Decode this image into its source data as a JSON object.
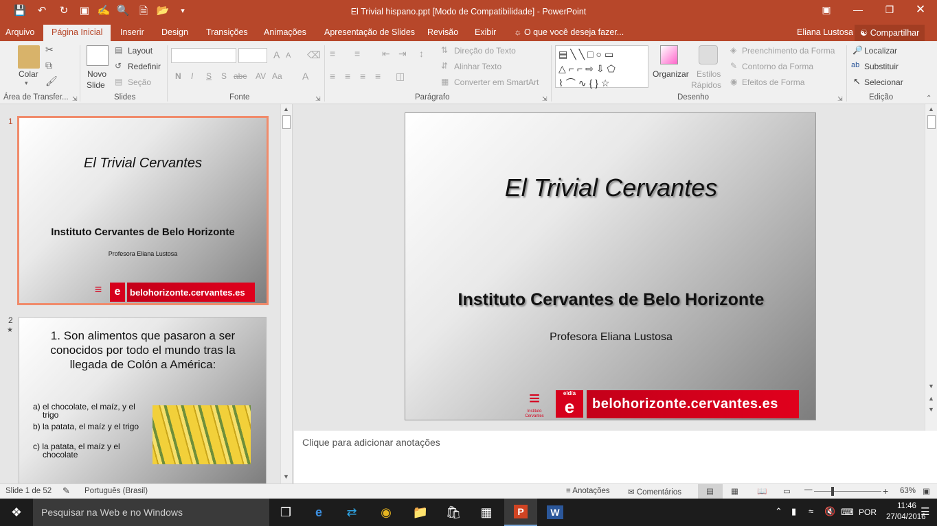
{
  "window": {
    "title": "El Trivial hispano.ppt [Modo de Compatibilidade] - PowerPoint"
  },
  "tabs": [
    "Arquivo",
    "Página Inicial",
    "Inserir",
    "Design",
    "Transições",
    "Animações",
    "Apresentação de Slides",
    "Revisão",
    "Exibir"
  ],
  "tell_me": "O que você deseja fazer...",
  "user": {
    "name": "Eliana Lustosa",
    "share": "Compartilhar"
  },
  "ribbon": {
    "clipboard": {
      "paste": "Colar",
      "group": "Área de Transfer..."
    },
    "slides": {
      "new_slide_1": "Novo",
      "new_slide_2": "Slide",
      "layout": "Layout",
      "reset": "Redefinir",
      "section": "Seção",
      "group": "Slides"
    },
    "font": {
      "group": "Fonte",
      "bold": "N",
      "italic": "I",
      "underline": "S",
      "strike": "S",
      "spacing": "abc",
      "case": "Aa",
      "color": "A",
      "grow": "A",
      "shrink": "A"
    },
    "paragraph": {
      "group": "Parágrafo",
      "text_direction": "Direção do Texto",
      "align_text": "Alinhar Texto",
      "smartart": "Converter em SmartArt"
    },
    "drawing": {
      "group": "Desenho",
      "arrange": "Organizar",
      "quick_styles_1": "Estilos",
      "quick_styles_2": "Rápidos",
      "fill": "Preenchimento da Forma",
      "outline": "Contorno da Forma",
      "effects": "Efeitos de Forma"
    },
    "editing": {
      "group": "Edição",
      "find": "Localizar",
      "replace": "Substituir",
      "select": "Selecionar"
    }
  },
  "thumbnails": [
    {
      "num": "1",
      "title": "El Trivial Cervantes",
      "subtitle": "Instituto Cervantes de Belo Horizonte",
      "author": "Profesora Eliana Lustosa",
      "banner": "belohorizonte.cervantes.es"
    },
    {
      "num": "2",
      "star": "★",
      "question": "1. Son alimentos que pasaron a ser conocidos por todo el mundo tras la llegada de Colón a América:",
      "options": [
        "a) el chocolate, el maíz, y el trigo",
        "b) la patata, el maíz y el trigo",
        "c) la patata, el maíz y el chocolate"
      ]
    }
  ],
  "main_slide": {
    "title": "El Trivial Cervantes",
    "subtitle": "Instituto Cervantes de Belo Horizonte",
    "author": "Profesora Eliana Lustosa",
    "banner": "belohorizonte.cervantes.es",
    "logo_text": "eldía",
    "logo_letter": "e",
    "ic_name": "Instituto Cervantes"
  },
  "notes_placeholder": "Clique para adicionar anotações",
  "status": {
    "slide": "Slide 1 de 52",
    "language": "Português (Brasil)",
    "notes": "Anotações",
    "comments": "Comentários",
    "zoom": "63%"
  },
  "taskbar": {
    "search": "Pesquisar na Web e no Windows",
    "lang": "POR",
    "time": "11:46",
    "date": "27/04/2016"
  },
  "colors": {
    "accent": "#b7472a",
    "banner_red": "#d6001c"
  }
}
